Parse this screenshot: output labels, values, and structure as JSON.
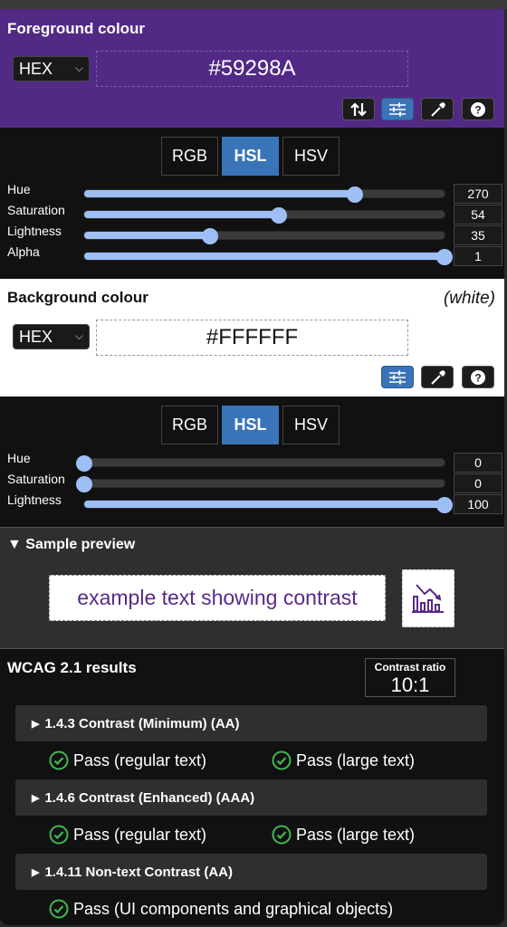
{
  "foreground": {
    "title": "Foreground colour",
    "format": "HEX",
    "value": "#59298A",
    "color": "#59298A",
    "buttons": [
      "swap-colours",
      "sliders",
      "eyedropper",
      "help"
    ],
    "tabs": [
      {
        "label": "RGB",
        "active": false
      },
      {
        "label": "HSL",
        "active": true
      },
      {
        "label": "HSV",
        "active": false
      }
    ],
    "sliders": [
      {
        "label": "Hue",
        "value": "270",
        "fraction": 0.75
      },
      {
        "label": "Saturation",
        "value": "54",
        "fraction": 0.54
      },
      {
        "label": "Lightness",
        "value": "35",
        "fraction": 0.35
      },
      {
        "label": "Alpha",
        "value": "1",
        "fraction": 1.0
      }
    ]
  },
  "background": {
    "title": "Background colour",
    "name": "(white)",
    "format": "HEX",
    "value": "#FFFFFF",
    "buttons": [
      "sliders",
      "eyedropper",
      "help"
    ],
    "tabs": [
      {
        "label": "RGB",
        "active": false
      },
      {
        "label": "HSL",
        "active": true
      },
      {
        "label": "HSV",
        "active": false
      }
    ],
    "sliders": [
      {
        "label": "Hue",
        "value": "0",
        "fraction": 0.0
      },
      {
        "label": "Saturation",
        "value": "0",
        "fraction": 0.0
      },
      {
        "label": "Lightness",
        "value": "100",
        "fraction": 1.0
      }
    ]
  },
  "sample": {
    "title": "Sample preview",
    "toggle_glyph": "▼",
    "text": "example text showing contrast",
    "icon": "chart-trend-down-icon"
  },
  "results": {
    "title": "WCAG 2.1 results",
    "ratio_label": "Contrast ratio",
    "ratio_value": "10:1",
    "criteria": [
      {
        "label": "1.4.3 Contrast (Minimum) (AA)",
        "results": [
          "Pass (regular text)",
          "Pass (large text)"
        ]
      },
      {
        "label": "1.4.6 Contrast (Enhanced) (AAA)",
        "results": [
          "Pass (regular text)",
          "Pass (large text)"
        ]
      },
      {
        "label": "1.4.11 Non-text Contrast (AA)",
        "results": [
          "Pass (UI components and graphical objects)"
        ]
      }
    ]
  },
  "colors": {
    "accent": "#3a74b8",
    "slider": "#9dbff5",
    "pass": "#3fb950"
  }
}
